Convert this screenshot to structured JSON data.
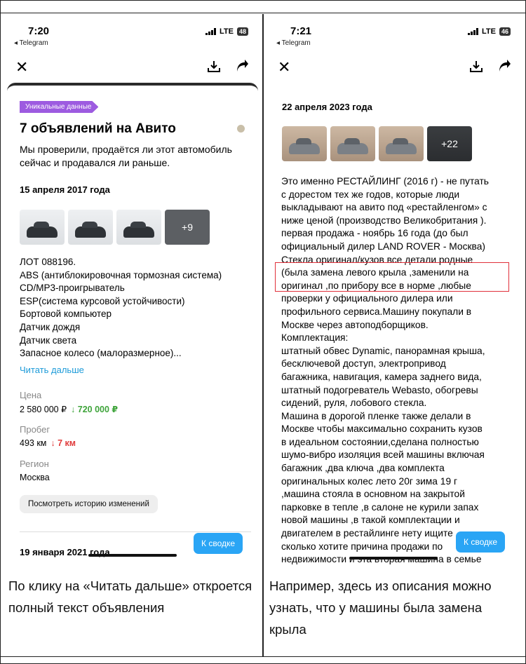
{
  "left": {
    "status": {
      "time": "7:20",
      "back_app": "◂ Telegram",
      "network": "LTE",
      "battery": "48"
    },
    "badge": "Уникальные данные",
    "title": "7 объявлений на Авито",
    "subtitle": "Мы проверили, продаётся ли этот автомобиль сейчас и продавался ли раньше.",
    "date1": "15 апреля 2017 года",
    "more_photos": "+9",
    "listing_lines": [
      "ЛОТ 088196.",
      "ABS (антиблокировочная тормозная система)",
      "CD/MP3-проигрыватель",
      "ESP(система курсовой устойчивости)",
      "Бортовой компьютер",
      "Датчик дождя",
      "Датчик света",
      "Запасное колесо (малоразмерное)..."
    ],
    "read_more": "Читать дальше",
    "price_label": "Цена",
    "price_value": "2 580 000 ₽",
    "price_delta": "↓ 720 000 ₽",
    "mileage_label": "Пробег",
    "mileage_value": "493 км",
    "mileage_delta": "↓ 7 км",
    "region_label": "Регион",
    "region_value": "Москва",
    "history_button": "Посмотреть историю изменений",
    "date2": "19 января 2021 года",
    "summary_button": "К сводке",
    "caption": "По клику на «Читать дальше» откроется полный текст объявления"
  },
  "right": {
    "status": {
      "time": "7:21",
      "back_app": "◂ Telegram",
      "network": "LTE",
      "battery": "46"
    },
    "date": "22 апреля 2023 года",
    "more_photos": "+22",
    "text_lines": [
      "Это именно РЕСТАЙЛИНГ (2016 г) - не путать",
      "с дорестом тех же годов, которые люди",
      "выкладывают на авито под «рестайленгом» с",
      "ниже ценой (производство Великобритания ).",
      "первая продажа - ноябрь 16 года (до был",
      "официальный дилер LAND ROVER - Москва)",
      "Стекла оригинал/кузов все детали родные",
      "(была замена левого крыла ,заменили на",
      "оригинал ,по прибору все в норме ,любые",
      "проверки у официального дилера или",
      "профильного сервиса.Машину покупали в",
      "Москве через автоподборщиков.",
      "Комплектация:",
      "штатный обвес Dynamic, панорамная крыша,",
      "бесключевой доступ, электропривод",
      "багажника, навигация, камера заднего вида,",
      "штатный подогреватель Webasto, обогревы",
      "сидений, руля, лобового стекла.",
      "Машина в дорогой пленке также делали в",
      "Москве чтобы максимально сохранить кузов",
      "в идеальном состоянии,сделана полностью",
      "шумо-вибро изоляция всей машины включая",
      "багажник ,два ключа ,два комплекта",
      "оригинальных колес лето 20г зима 19 г",
      ",машина стояла в основном на закрытой",
      "парковке в тепле ,в салоне не курили запах",
      "новой машины ,в такой комплектации и",
      "двигателем в рестайлинге нету ищите",
      "сколько хотите причина продажи по",
      "недвижимости и эта вторая машина в семье"
    ],
    "summary_button": "К сводке",
    "caption": "Например, здесь из описания можно узнать, что у машины была замена крыла"
  }
}
